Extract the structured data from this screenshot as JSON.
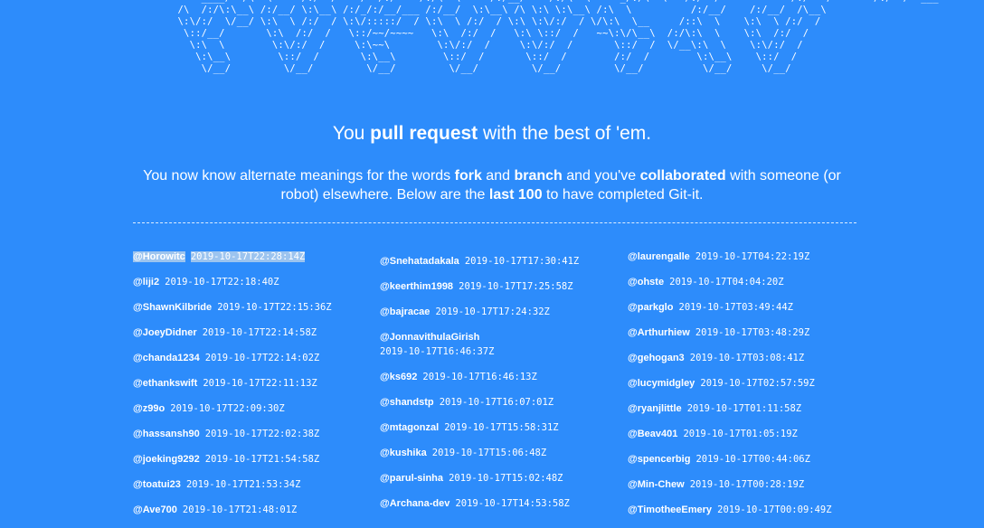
{
  "ascii_art": "     ____/  /\\  \\     /:/  /    /  /:/    /:/\\  \\     /:/__/    /:/\\  \\     _/:/\\  \\   /:/  /            /:/   /       /:/  /  ___\n /\\  /:/\\:\\__\\ /:/__/ \\:\\__\\ /:/_/:/__/___ /:/__/  \\:\\__\\ /\\ \\:\\ \\:\\__\\ /:\\  \\          /:/__/    /:/__/  /\\__\\\n \\:\\/:/  \\/__/ \\:\\  \\ /:/  / \\:\\/:::::/  / \\:\\  \\ /:/  / \\:\\ \\:\\/:/  / \\/\\:\\  \\__     /::\\  \\    \\:\\  \\ /:/  /\n  \\::/__/       \\:\\  /:/  /   \\::/~~/~~~~   \\:\\  /:/  /   \\:\\ \\::/  /   ~~\\:\\/\\__\\  /:/\\:\\  \\    \\:\\  /:/  /\n   \\:\\  \\        \\:\\/:/  /     \\:\\~~\\        \\:\\/:/  /     \\:\\/:/  /       \\::/  /  \\/__\\:\\  \\    \\:\\/:/  /\n    \\:\\__\\        \\::/  /       \\:\\__\\        \\::/  /       \\::/  /        /:/  /        \\:\\__\\    \\::/  /\n     \\/__/         \\/__/         \\/__/         \\/__/         \\/__/         \\/__/          \\/__/     \\/__/",
  "headline": {
    "pre": "You ",
    "bold": "pull request",
    "post": " with the best of 'em."
  },
  "description": {
    "t1": "You now know alternate meanings for the words ",
    "b1": "fork",
    "t2": " and ",
    "b2": "branch",
    "t3": " and you've ",
    "b3": "collaborated",
    "t4": " with someone (or robot) elsewhere. Below are the ",
    "b4": "last 100",
    "t5": " to have completed Git-it."
  },
  "columns": [
    [
      {
        "user": "@Horowitc",
        "time": "2019-10-17T22:28:14Z"
      },
      {
        "user": "@liji2",
        "time": "2019-10-17T22:18:40Z"
      },
      {
        "user": "@ShawnKilbride",
        "time": "2019-10-17T22:15:36Z"
      },
      {
        "user": "@JoeyDidner",
        "time": "2019-10-17T22:14:58Z"
      },
      {
        "user": "@chanda1234",
        "time": "2019-10-17T22:14:02Z"
      },
      {
        "user": "@ethankswift",
        "time": "2019-10-17T22:11:13Z"
      },
      {
        "user": "@z99o",
        "time": "2019-10-17T22:09:30Z"
      },
      {
        "user": "@hassansh90",
        "time": "2019-10-17T22:02:38Z"
      },
      {
        "user": "@joeking9292",
        "time": "2019-10-17T21:54:58Z"
      },
      {
        "user": "@toatui23",
        "time": "2019-10-17T21:53:34Z"
      },
      {
        "user": "@Ave700",
        "time": "2019-10-17T21:48:01Z"
      }
    ],
    [
      {
        "user": "@Snehatadakala",
        "time": "2019-10-17T17:30:41Z"
      },
      {
        "user": "@keerthim1998",
        "time": "2019-10-17T17:25:58Z"
      },
      {
        "user": "@bajracae",
        "time": "2019-10-17T17:24:32Z"
      },
      {
        "user": "@JonnavithulaGirish",
        "time": "2019-10-17T16:46:37Z"
      },
      {
        "user": "@ks692",
        "time": "2019-10-17T16:46:13Z"
      },
      {
        "user": "@shandstp",
        "time": "2019-10-17T16:07:01Z"
      },
      {
        "user": "@mtagonzal",
        "time": "2019-10-17T15:58:31Z"
      },
      {
        "user": "@kushika",
        "time": "2019-10-17T15:06:48Z"
      },
      {
        "user": "@parul-sinha",
        "time": "2019-10-17T15:02:48Z"
      },
      {
        "user": "@Archana-dev",
        "time": "2019-10-17T14:53:58Z"
      }
    ],
    [
      {
        "user": "@laurengalle",
        "time": "2019-10-17T04:22:19Z"
      },
      {
        "user": "@ohste",
        "time": "2019-10-17T04:04:20Z"
      },
      {
        "user": "@parkglo",
        "time": "2019-10-17T03:49:44Z"
      },
      {
        "user": "@Arthurhiew",
        "time": "2019-10-17T03:48:29Z"
      },
      {
        "user": "@gehogan3",
        "time": "2019-10-17T03:08:41Z"
      },
      {
        "user": "@lucymidgley",
        "time": "2019-10-17T02:57:59Z"
      },
      {
        "user": "@ryanjlittle",
        "time": "2019-10-17T01:11:58Z"
      },
      {
        "user": "@Beav401",
        "time": "2019-10-17T01:05:19Z"
      },
      {
        "user": "@spencerbig",
        "time": "2019-10-17T00:44:06Z"
      },
      {
        "user": "@Min-Chew",
        "time": "2019-10-17T00:28:19Z"
      },
      {
        "user": "@TimotheeEmery",
        "time": "2019-10-17T00:09:49Z"
      }
    ]
  ],
  "colors": {
    "background": "#2d8cfb",
    "text": "#ffffff",
    "selection": "#9cc4ef"
  }
}
